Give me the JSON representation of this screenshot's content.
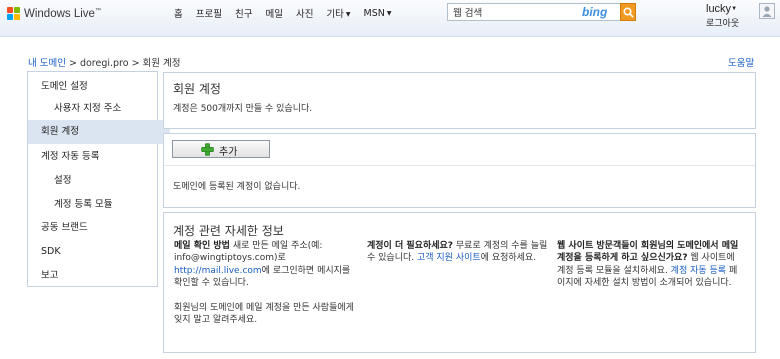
{
  "brand": {
    "logo_text": "Windows Live",
    "trademark": "™"
  },
  "nav": {
    "items": [
      {
        "label": "홈",
        "dropdown": false
      },
      {
        "label": "프로필",
        "dropdown": false
      },
      {
        "label": "친구",
        "dropdown": false
      },
      {
        "label": "메일",
        "dropdown": false
      },
      {
        "label": "사진",
        "dropdown": false
      },
      {
        "label": "기타",
        "dropdown": true
      },
      {
        "label": "MSN",
        "dropdown": true
      }
    ]
  },
  "search": {
    "value": "웹 검색",
    "engine_label": "bing"
  },
  "user": {
    "name": "lucky",
    "sign_out": "로그아웃"
  },
  "breadcrumb": {
    "home": "내 도메인",
    "sep": ">",
    "domain": "doregi.pro",
    "current": "회원 계정"
  },
  "help": "도움말",
  "sidebar": {
    "items": [
      {
        "label": "도메인 설정"
      },
      {
        "label": "사용자 지정 주소"
      },
      {
        "label": "회원 계정"
      },
      {
        "label": "계정 자동 등록"
      },
      {
        "label": "설정"
      },
      {
        "label": "계정 등록 모듈"
      },
      {
        "label": "공동 브랜드"
      },
      {
        "label": "SDK"
      },
      {
        "label": "보고"
      }
    ],
    "selected_index": 2
  },
  "accounts": {
    "title": "회원 계정",
    "limit_text": "계정은 500개까지 만들 수 있습니다.",
    "add_button": "추가",
    "empty_text": "도메인에 등록된 계정이 없습니다."
  },
  "info": {
    "title": "계정 관련 자세한 정보",
    "col1": {
      "bold": "메일 확인 방법",
      "text1": " 새로 만든 메일 주소(예: info@wingtiptoys.com)로 ",
      "link": "http://mail.live.com",
      "text2": "에 로그인하면 메시지를 확인할 수 있습니다.",
      "para2": "회원님의 도메인에 메일 계정을 만든 사람들에게 잊지 말고 알려주세요."
    },
    "col2": {
      "bold": "계정이 더 필요하세요?",
      "text1": " 무료로 계정의 수를 늘릴 수 있습니다. ",
      "link": "고객 지원 사이트",
      "text2": "에 요청하세요."
    },
    "col3": {
      "bold": "웹 사이트 방문객들이 회원님의 도메인에서 메일 계정을 등록하게 하고 싶으신가요?",
      "text1": " 웹 사이트에 계정 등록 모듈을 설치하세요. ",
      "link": "계정 자동 등록",
      "text2": " 페이지에 자세한 설치 방법이 소개되어 있습니다."
    }
  },
  "icons": {
    "logo": "windows-flag-icon",
    "search": "magnifier-icon",
    "avatar": "user-avatar-icon",
    "add": "green-plus-icon"
  },
  "colors": {
    "link": "#1a5ec2",
    "selected_bg": "#dbe5f1",
    "search_button": "#f09a1f",
    "add_icon": "#3fa832"
  }
}
